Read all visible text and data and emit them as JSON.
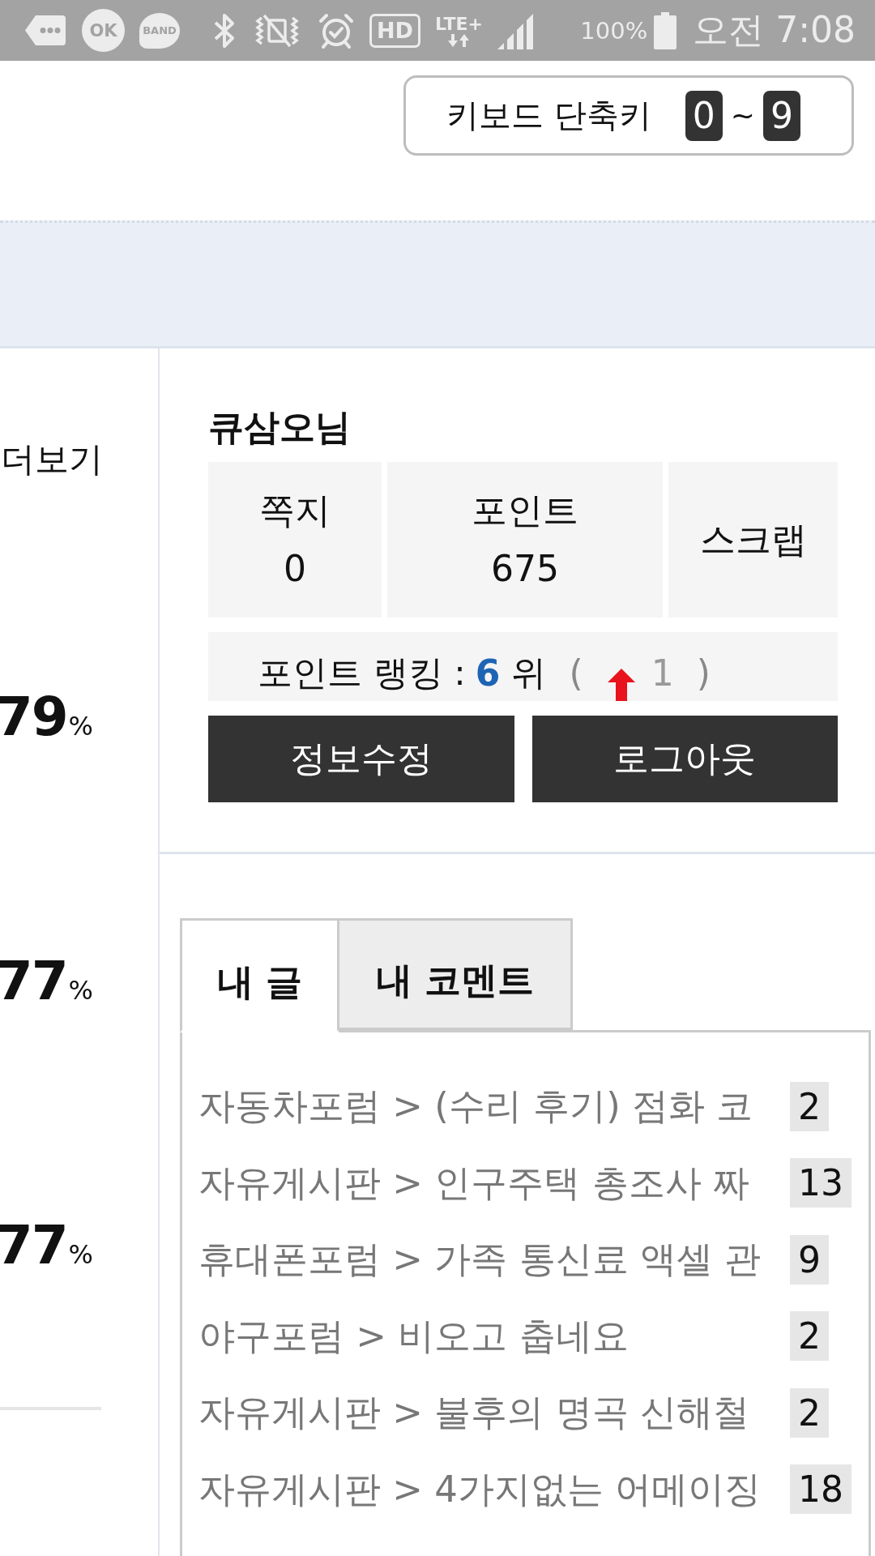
{
  "status_bar": {
    "icons": [
      {
        "kind": "chat"
      },
      {
        "kind": "ok_cashbag",
        "label": "OK"
      },
      {
        "kind": "band",
        "label": "BAND"
      },
      {
        "kind": "bluetooth"
      },
      {
        "kind": "vibrate_off"
      },
      {
        "kind": "alarm"
      },
      {
        "kind": "hd",
        "label": "HD"
      },
      {
        "kind": "lte",
        "label": "LTE+"
      },
      {
        "kind": "signal"
      }
    ],
    "battery": "100%",
    "time": "오전 7:08"
  },
  "shortcut_hint": {
    "label": "키보드 단축키",
    "first_key": "0",
    "separator": "~",
    "last_key": "9"
  },
  "left_column": {
    "more_link": "더보기",
    "stats": [
      {
        "value": "79",
        "unit": "%"
      },
      {
        "value": "77",
        "unit": "%"
      },
      {
        "value": "77",
        "unit": "%"
      }
    ]
  },
  "profile": {
    "username": "큐삼오님",
    "stats": [
      {
        "label": "쪽지",
        "value": "0"
      },
      {
        "label": "포인트",
        "value": "675"
      },
      {
        "label": "스크랩"
      }
    ],
    "ranking": {
      "label": "포인트 랭킹 :",
      "rank": "6",
      "unit": "위",
      "open": "(",
      "rising": true,
      "change": "1",
      "close": ")"
    },
    "buttons": [
      "정보수정",
      "로그아웃"
    ]
  },
  "activity": {
    "tabs": [
      {
        "label": "내 글",
        "selected": true
      },
      {
        "label": "내 코멘트",
        "selected": false
      }
    ],
    "posts": [
      {
        "title": "자동차포럼 > (수리 후기) 점화 코",
        "count": "2"
      },
      {
        "title": "자유게시판 > 인구주택 총조사 짜",
        "count": "13"
      },
      {
        "title": "휴대폰포럼 > 가족 통신료 액셀 관",
        "count": "9"
      },
      {
        "title": "야구포럼 > 비오고 춥네요",
        "count": "2"
      },
      {
        "title": "자유게시판 > 불후의 명곡 신해철",
        "count": "2"
      },
      {
        "title": "자유게시판 > 4가지없는 어메이징",
        "count": "18"
      }
    ]
  }
}
